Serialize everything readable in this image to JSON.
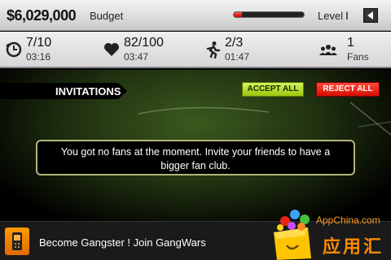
{
  "header": {
    "budget_value": "$6,029,000",
    "budget_label": "Budget",
    "level_label": "Level",
    "level_value": "I",
    "level_progress": 0.12
  },
  "stats": [
    {
      "icon": "clock-icon",
      "main": "7/10",
      "sub": "03:16"
    },
    {
      "icon": "heart-icon",
      "main": "82/100",
      "sub": "03:47"
    },
    {
      "icon": "runner-icon",
      "main": "2/3",
      "sub": "01:47"
    },
    {
      "icon": "group-icon",
      "main": "1",
      "sub": "Fans"
    }
  ],
  "invitations": {
    "title": "INVITATIONS",
    "accept_label": "ACCEPT ALL",
    "reject_label": "REJECT ALL",
    "message": "You got no fans at the moment. Invite your friends to have a bigger fan club."
  },
  "ad": {
    "text": "Become Gangster ! Join GangWars",
    "logo_site": "AppChina.com",
    "logo_text": "应用汇"
  },
  "colors": {
    "accept": "#b5dd2a",
    "reject": "#e8180a",
    "level_fill": "#e01010"
  }
}
